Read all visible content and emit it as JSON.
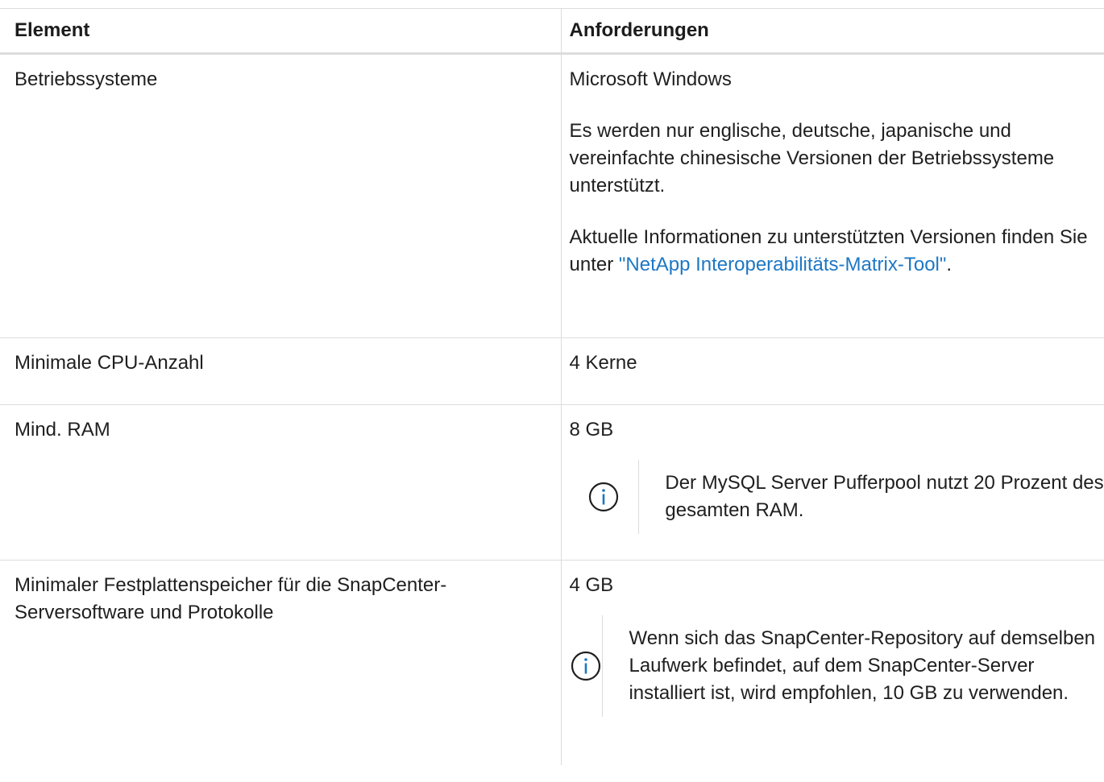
{
  "table": {
    "headers": [
      "Element",
      "Anforderungen"
    ],
    "rows": [
      {
        "element": "Betriebssysteme",
        "paragraphs": [
          "Microsoft Windows",
          "Es werden nur englische, deutsche, japanische und vereinfachte chinesische Versionen der Betriebssysteme unterstützt."
        ],
        "link_prefix": "Aktuelle Informationen zu unterstützten Versionen finden Sie unter ",
        "link_text": "\"NetApp Interoperabilitäts-Matrix-Tool\"",
        "link_suffix": "."
      },
      {
        "element": "Minimale CPU-Anzahl",
        "value": "4 Kerne"
      },
      {
        "element": "Mind. RAM",
        "value": "8 GB",
        "note": "Der MySQL Server Pufferpool nutzt 20 Prozent des gesamten RAM."
      },
      {
        "element": "Minimaler Festplattenspeicher für die SnapCenter-Serversoftware und Protokolle",
        "value": "4 GB",
        "note": "Wenn sich das SnapCenter-Repository auf demselben Laufwerk befindet, auf dem SnapCenter-Server installiert ist, wird empfohlen, 10 GB zu verwenden."
      }
    ]
  },
  "icons": {
    "info": "info-circle-icon"
  },
  "colors": {
    "link": "#1d77c4",
    "icon": "#1d77c4",
    "border": "#dcdcdc"
  }
}
